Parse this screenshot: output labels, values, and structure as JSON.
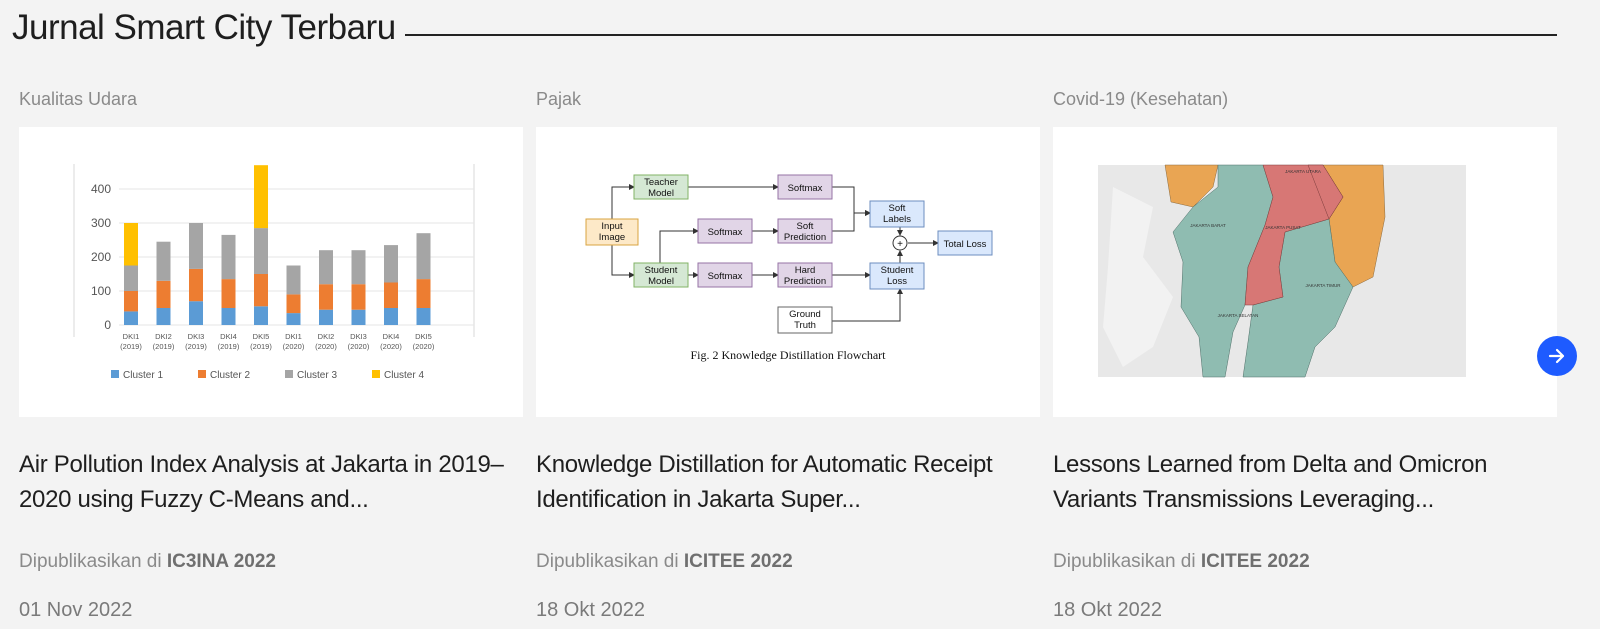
{
  "section": {
    "title": "Jurnal Smart City Terbaru"
  },
  "cards": [
    {
      "category": "Kualitas Udara",
      "title": "Air Pollution Index Analysis at Jakarta in 2019–2020 using Fuzzy C-Means and...",
      "venue_prefix": "Dipublikasikan di",
      "venue": "IC3INA 2022",
      "date": "01 Nov 2022"
    },
    {
      "category": "Pajak",
      "title": "Knowledge Distillation for Automatic Receipt Identification in Jakarta Super...",
      "venue_prefix": "Dipublikasikan di",
      "venue": "ICITEE 2022",
      "date": "18 Okt 2022"
    },
    {
      "category": "Covid-19 (Kesehatan)",
      "title": "Lessons Learned from Delta and Omicron Variants Transmissions Leveraging...",
      "venue_prefix": "Dipublikasikan di",
      "venue": "ICITEE 2022",
      "date": "18 Okt 2022"
    }
  ],
  "thumbnail_chart": {
    "y_ticks": [
      "400",
      "300",
      "200",
      "100",
      "0"
    ],
    "categories": [
      "DKI1 (2019)",
      "DKI2 (2019)",
      "DKI3 (2019)",
      "DKI4 (2019)",
      "DKI5 (2019)",
      "DKI1 (2020)",
      "DKI2 (2020)",
      "DKI3 (2020)",
      "DKI4 (2020)",
      "DKI5 (2020)"
    ],
    "legend": [
      "Cluster 1",
      "Cluster 2",
      "Cluster 3",
      "Cluster 4"
    ],
    "colors": [
      "#5b9bd5",
      "#ed7d31",
      "#a5a5a5",
      "#ffc000"
    ]
  },
  "flowchart": {
    "input": [
      "Input",
      "Image"
    ],
    "teacher": [
      "Teacher",
      "Model"
    ],
    "student": [
      "Student",
      "Model"
    ],
    "softmax": "Softmax",
    "soft_pred": [
      "Soft",
      "Prediction"
    ],
    "hard_pred": [
      "Hard",
      "Prediction"
    ],
    "soft_labels": [
      "Soft",
      "Labels"
    ],
    "student_loss": [
      "Student",
      "Loss"
    ],
    "total_loss": "Total Loss",
    "ground_truth": [
      "Ground",
      "Truth"
    ],
    "plus": "+",
    "caption": "Fig. 2 Knowledge Distillation Flowchart"
  },
  "map": {
    "labels": [
      "JAKARTA UTARA",
      "JAKARTA BARAT",
      "JAKARTA PUSAT",
      "JAKARTA TIMUR",
      "JAKARTA SELATAN"
    ]
  },
  "next_button": {
    "icon": "arrow-right-icon",
    "color": "#1e5bff"
  }
}
